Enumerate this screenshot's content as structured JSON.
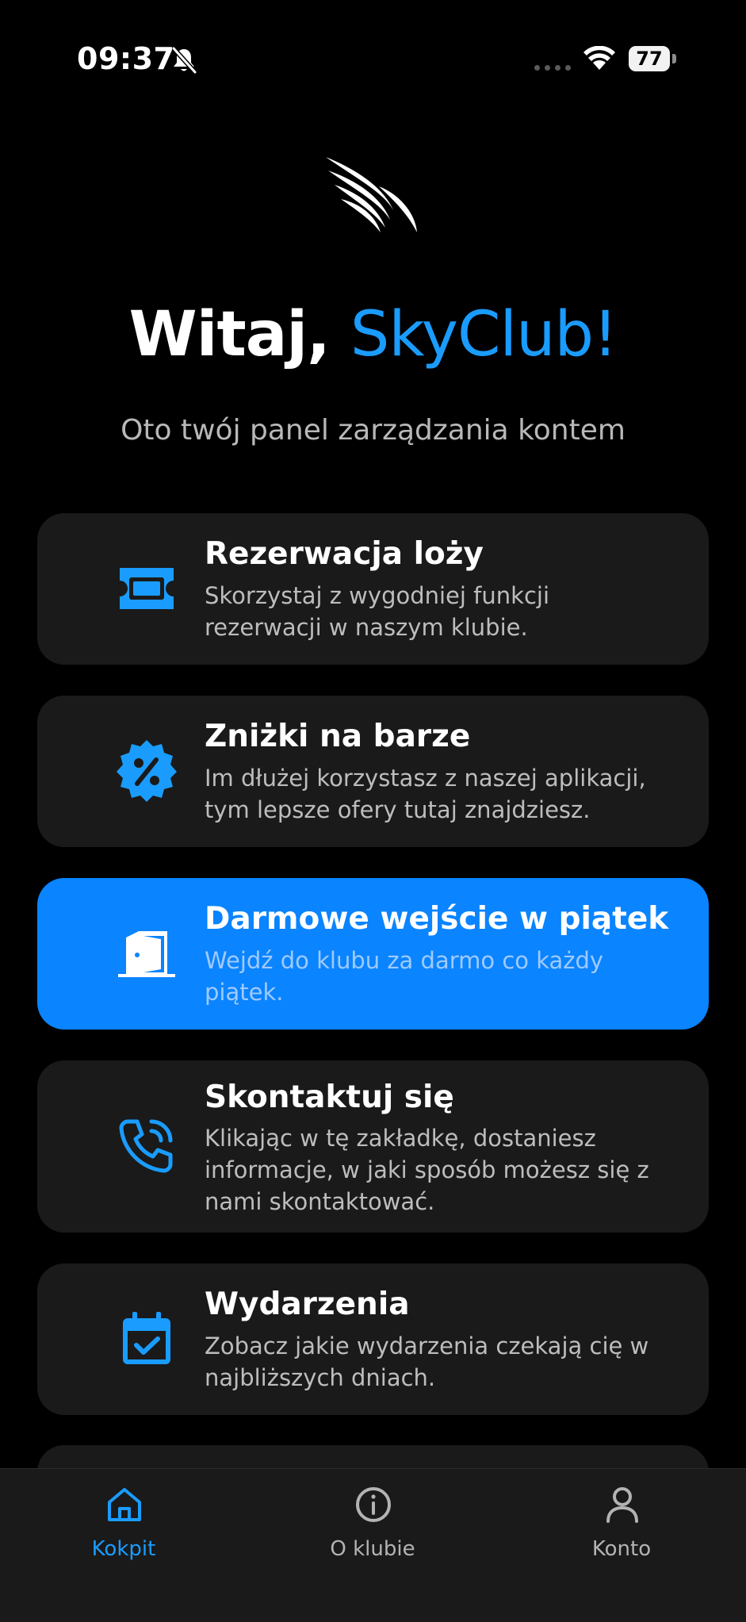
{
  "status_bar": {
    "time": "09:37",
    "battery": "77"
  },
  "header": {
    "greeting_prefix": "Witaj, ",
    "greeting_brand": "SkyClub!",
    "subtitle": "Oto twój panel zarządzania kontem",
    "logo_icon": "wings-logo-icon"
  },
  "cards": [
    {
      "title": "Rezerwacja loży",
      "description": "Skorzystaj z wygodniej funkcji rezerwacji w naszym klubie.",
      "icon": "ticket-icon"
    },
    {
      "title": "Zniżki na barze",
      "description": "Im dłużej korzystasz z naszej aplikacji, tym lepsze ofery tutaj znajdziesz.",
      "icon": "discount-badge-icon"
    },
    {
      "title": "Darmowe wejście w piątek",
      "description": "Wejdź do klubu za darmo co każdy piątek.",
      "icon": "door-icon",
      "active": true
    },
    {
      "title": "Skontaktuj się",
      "description": "Klikając w tę zakładkę, dostaniesz informacje, w jaki sposób możesz się z nami skontaktować.",
      "icon": "phone-call-icon"
    },
    {
      "title": "Wydarzenia",
      "description": "Zobacz jakie wydarzenia czekają cię w najbliższych dniach.",
      "icon": "calendar-check-icon"
    }
  ],
  "bottom_nav": [
    {
      "label": "Kokpit",
      "icon": "home-icon",
      "active": true
    },
    {
      "label": "O klubie",
      "icon": "info-icon",
      "active": false
    },
    {
      "label": "Konto",
      "icon": "user-icon",
      "active": false
    }
  ],
  "colors": {
    "accent": "#1a9cff",
    "active_card": "#0a84ff",
    "card_bg": "#1a1a1a",
    "background": "#000000"
  }
}
